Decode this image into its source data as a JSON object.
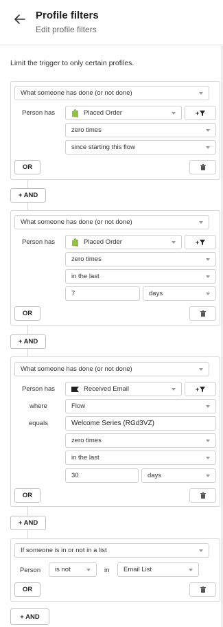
{
  "header": {
    "title": "Profile filters",
    "subtitle": "Edit profile filters"
  },
  "intro": "Limit the trigger to only certain profiles.",
  "labels": {
    "person_has": "Person has",
    "where": "where",
    "equals": "equals",
    "person": "Person",
    "in": "in"
  },
  "buttons": {
    "or": "OR",
    "and": "+ AND",
    "add_and": "+ AND",
    "filter": "+"
  },
  "groups": [
    {
      "type": "What someone has done (or not done)",
      "metric": "Placed Order",
      "frequency": "zero times",
      "timeframe": "since starting this flow"
    },
    {
      "type": "What someone has done (or not done)",
      "metric": "Placed Order",
      "frequency": "zero times",
      "timeframe": "in the last",
      "amount": "7",
      "unit": "days"
    },
    {
      "type": "What someone has done (or not done)",
      "metric": "Received Email",
      "where_field": "Flow",
      "equals_value": "Welcome Series (RGd3VZ)",
      "frequency": "zero times",
      "timeframe": "in the last",
      "amount": "30",
      "unit": "days"
    },
    {
      "type": "If someone is in or not in a list",
      "condition": "is not",
      "list": "Email List"
    }
  ],
  "icons": {
    "back": "arrow-left-icon",
    "shopify": "shopify-icon",
    "email_flag": "flag-icon",
    "filter": "filter-icon",
    "delete": "trash-icon"
  }
}
